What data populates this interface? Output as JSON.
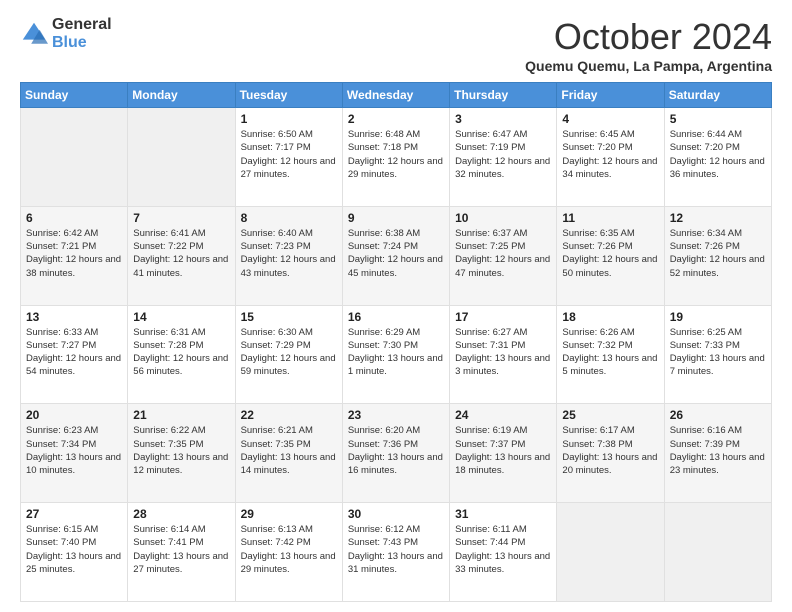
{
  "logo": {
    "general": "General",
    "blue": "Blue"
  },
  "header": {
    "month": "October 2024",
    "location": "Quemu Quemu, La Pampa, Argentina"
  },
  "weekdays": [
    "Sunday",
    "Monday",
    "Tuesday",
    "Wednesday",
    "Thursday",
    "Friday",
    "Saturday"
  ],
  "weeks": [
    [
      null,
      null,
      {
        "day": "1",
        "sunrise": "Sunrise: 6:50 AM",
        "sunset": "Sunset: 7:17 PM",
        "daylight": "Daylight: 12 hours and 27 minutes."
      },
      {
        "day": "2",
        "sunrise": "Sunrise: 6:48 AM",
        "sunset": "Sunset: 7:18 PM",
        "daylight": "Daylight: 12 hours and 29 minutes."
      },
      {
        "day": "3",
        "sunrise": "Sunrise: 6:47 AM",
        "sunset": "Sunset: 7:19 PM",
        "daylight": "Daylight: 12 hours and 32 minutes."
      },
      {
        "day": "4",
        "sunrise": "Sunrise: 6:45 AM",
        "sunset": "Sunset: 7:20 PM",
        "daylight": "Daylight: 12 hours and 34 minutes."
      },
      {
        "day": "5",
        "sunrise": "Sunrise: 6:44 AM",
        "sunset": "Sunset: 7:20 PM",
        "daylight": "Daylight: 12 hours and 36 minutes."
      }
    ],
    [
      {
        "day": "6",
        "sunrise": "Sunrise: 6:42 AM",
        "sunset": "Sunset: 7:21 PM",
        "daylight": "Daylight: 12 hours and 38 minutes."
      },
      {
        "day": "7",
        "sunrise": "Sunrise: 6:41 AM",
        "sunset": "Sunset: 7:22 PM",
        "daylight": "Daylight: 12 hours and 41 minutes."
      },
      {
        "day": "8",
        "sunrise": "Sunrise: 6:40 AM",
        "sunset": "Sunset: 7:23 PM",
        "daylight": "Daylight: 12 hours and 43 minutes."
      },
      {
        "day": "9",
        "sunrise": "Sunrise: 6:38 AM",
        "sunset": "Sunset: 7:24 PM",
        "daylight": "Daylight: 12 hours and 45 minutes."
      },
      {
        "day": "10",
        "sunrise": "Sunrise: 6:37 AM",
        "sunset": "Sunset: 7:25 PM",
        "daylight": "Daylight: 12 hours and 47 minutes."
      },
      {
        "day": "11",
        "sunrise": "Sunrise: 6:35 AM",
        "sunset": "Sunset: 7:26 PM",
        "daylight": "Daylight: 12 hours and 50 minutes."
      },
      {
        "day": "12",
        "sunrise": "Sunrise: 6:34 AM",
        "sunset": "Sunset: 7:26 PM",
        "daylight": "Daylight: 12 hours and 52 minutes."
      }
    ],
    [
      {
        "day": "13",
        "sunrise": "Sunrise: 6:33 AM",
        "sunset": "Sunset: 7:27 PM",
        "daylight": "Daylight: 12 hours and 54 minutes."
      },
      {
        "day": "14",
        "sunrise": "Sunrise: 6:31 AM",
        "sunset": "Sunset: 7:28 PM",
        "daylight": "Daylight: 12 hours and 56 minutes."
      },
      {
        "day": "15",
        "sunrise": "Sunrise: 6:30 AM",
        "sunset": "Sunset: 7:29 PM",
        "daylight": "Daylight: 12 hours and 59 minutes."
      },
      {
        "day": "16",
        "sunrise": "Sunrise: 6:29 AM",
        "sunset": "Sunset: 7:30 PM",
        "daylight": "Daylight: 13 hours and 1 minute."
      },
      {
        "day": "17",
        "sunrise": "Sunrise: 6:27 AM",
        "sunset": "Sunset: 7:31 PM",
        "daylight": "Daylight: 13 hours and 3 minutes."
      },
      {
        "day": "18",
        "sunrise": "Sunrise: 6:26 AM",
        "sunset": "Sunset: 7:32 PM",
        "daylight": "Daylight: 13 hours and 5 minutes."
      },
      {
        "day": "19",
        "sunrise": "Sunrise: 6:25 AM",
        "sunset": "Sunset: 7:33 PM",
        "daylight": "Daylight: 13 hours and 7 minutes."
      }
    ],
    [
      {
        "day": "20",
        "sunrise": "Sunrise: 6:23 AM",
        "sunset": "Sunset: 7:34 PM",
        "daylight": "Daylight: 13 hours and 10 minutes."
      },
      {
        "day": "21",
        "sunrise": "Sunrise: 6:22 AM",
        "sunset": "Sunset: 7:35 PM",
        "daylight": "Daylight: 13 hours and 12 minutes."
      },
      {
        "day": "22",
        "sunrise": "Sunrise: 6:21 AM",
        "sunset": "Sunset: 7:35 PM",
        "daylight": "Daylight: 13 hours and 14 minutes."
      },
      {
        "day": "23",
        "sunrise": "Sunrise: 6:20 AM",
        "sunset": "Sunset: 7:36 PM",
        "daylight": "Daylight: 13 hours and 16 minutes."
      },
      {
        "day": "24",
        "sunrise": "Sunrise: 6:19 AM",
        "sunset": "Sunset: 7:37 PM",
        "daylight": "Daylight: 13 hours and 18 minutes."
      },
      {
        "day": "25",
        "sunrise": "Sunrise: 6:17 AM",
        "sunset": "Sunset: 7:38 PM",
        "daylight": "Daylight: 13 hours and 20 minutes."
      },
      {
        "day": "26",
        "sunrise": "Sunrise: 6:16 AM",
        "sunset": "Sunset: 7:39 PM",
        "daylight": "Daylight: 13 hours and 23 minutes."
      }
    ],
    [
      {
        "day": "27",
        "sunrise": "Sunrise: 6:15 AM",
        "sunset": "Sunset: 7:40 PM",
        "daylight": "Daylight: 13 hours and 25 minutes."
      },
      {
        "day": "28",
        "sunrise": "Sunrise: 6:14 AM",
        "sunset": "Sunset: 7:41 PM",
        "daylight": "Daylight: 13 hours and 27 minutes."
      },
      {
        "day": "29",
        "sunrise": "Sunrise: 6:13 AM",
        "sunset": "Sunset: 7:42 PM",
        "daylight": "Daylight: 13 hours and 29 minutes."
      },
      {
        "day": "30",
        "sunrise": "Sunrise: 6:12 AM",
        "sunset": "Sunset: 7:43 PM",
        "daylight": "Daylight: 13 hours and 31 minutes."
      },
      {
        "day": "31",
        "sunrise": "Sunrise: 6:11 AM",
        "sunset": "Sunset: 7:44 PM",
        "daylight": "Daylight: 13 hours and 33 minutes."
      },
      null,
      null
    ]
  ]
}
